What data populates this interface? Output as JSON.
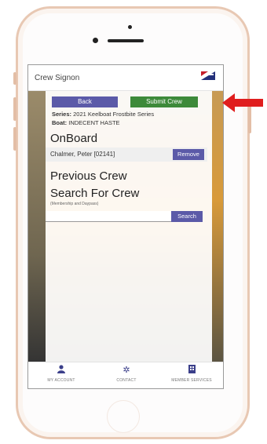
{
  "header": {
    "title": "Crew Signon",
    "flag_icon": "club-flag-icon"
  },
  "actions": {
    "back_label": "Back",
    "submit_label": "Submit Crew"
  },
  "details": {
    "series_label": "Series:",
    "series_value": "2021 Keelboat Frostbite Series",
    "boat_label": "Boat:",
    "boat_value": "INDECENT HASTE"
  },
  "onboard": {
    "title": "OnBoard",
    "crew": [
      {
        "name": "Chalmer, Peter [02141]",
        "remove_label": "Remove"
      }
    ]
  },
  "previous_crew": {
    "title": "Previous Crew"
  },
  "search": {
    "title": "Search For Crew",
    "hint": "(Membership and Daypass)",
    "input_value": "",
    "button_label": "Search"
  },
  "nav": [
    {
      "label": "MY ACCOUNT",
      "icon": "person-icon"
    },
    {
      "label": "CONTACT",
      "icon": "gear-icon"
    },
    {
      "label": "MEMBER SERVICES",
      "icon": "building-icon"
    }
  ],
  "colors": {
    "primary_button": "#5b5aa8",
    "submit_button": "#3d8a3a",
    "annotation_arrow": "#e01e1e"
  }
}
